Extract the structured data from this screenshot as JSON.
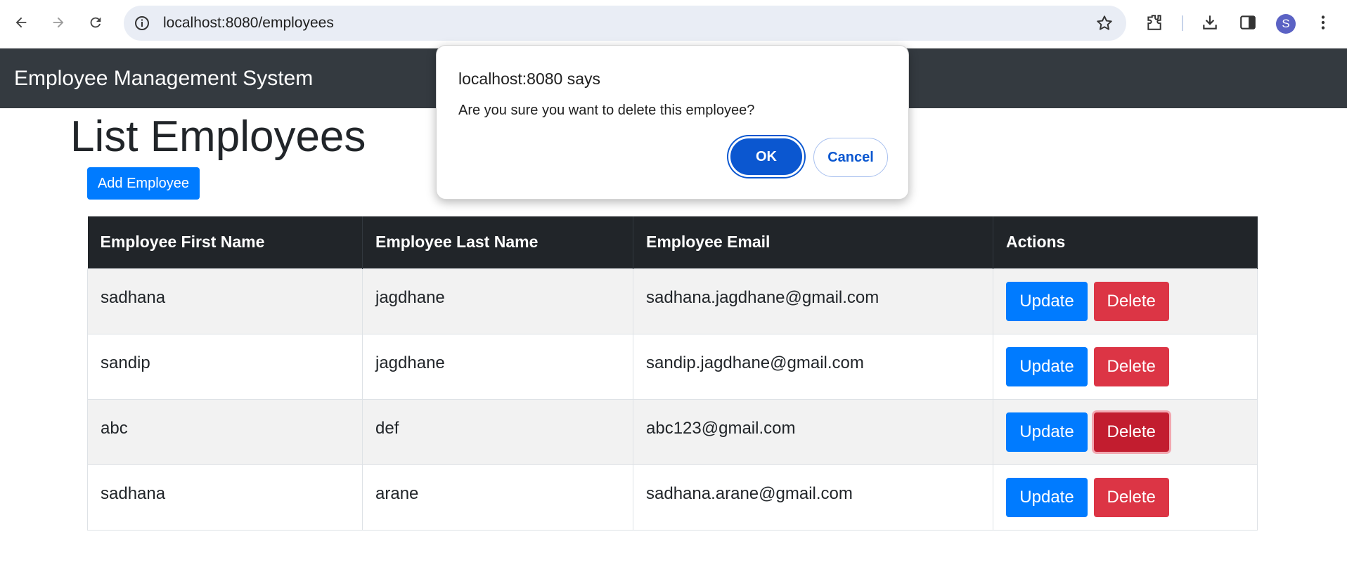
{
  "browser": {
    "url": "localhost:8080/employees",
    "profile_initial": "S"
  },
  "app": {
    "brand": "Employee Management System"
  },
  "page": {
    "title": "List Employees",
    "add_button": "Add Employee"
  },
  "table": {
    "headers": [
      "Employee First Name",
      "Employee Last Name",
      "Employee Email",
      "Actions"
    ],
    "rows": [
      {
        "first": "sadhana",
        "last": "jagdhane",
        "email": "sadhana.jagdhane@gmail.com"
      },
      {
        "first": "sandip",
        "last": "jagdhane",
        "email": "sandip.jagdhane@gmail.com"
      },
      {
        "first": "abc",
        "last": "def",
        "email": "abc123@gmail.com"
      },
      {
        "first": "sadhana",
        "last": "arane",
        "email": "sadhana.arane@gmail.com"
      }
    ],
    "update_label": "Update",
    "delete_label": "Delete"
  },
  "dialog": {
    "title": "localhost:8080 says",
    "message": "Are you sure you want to delete this employee?",
    "ok_label": "OK",
    "cancel_label": "Cancel"
  },
  "colors": {
    "primary": "#007bff",
    "danger": "#dc3545",
    "navbar": "#343a40",
    "table_header": "#212529",
    "dialog_accent": "#0b57d0"
  }
}
